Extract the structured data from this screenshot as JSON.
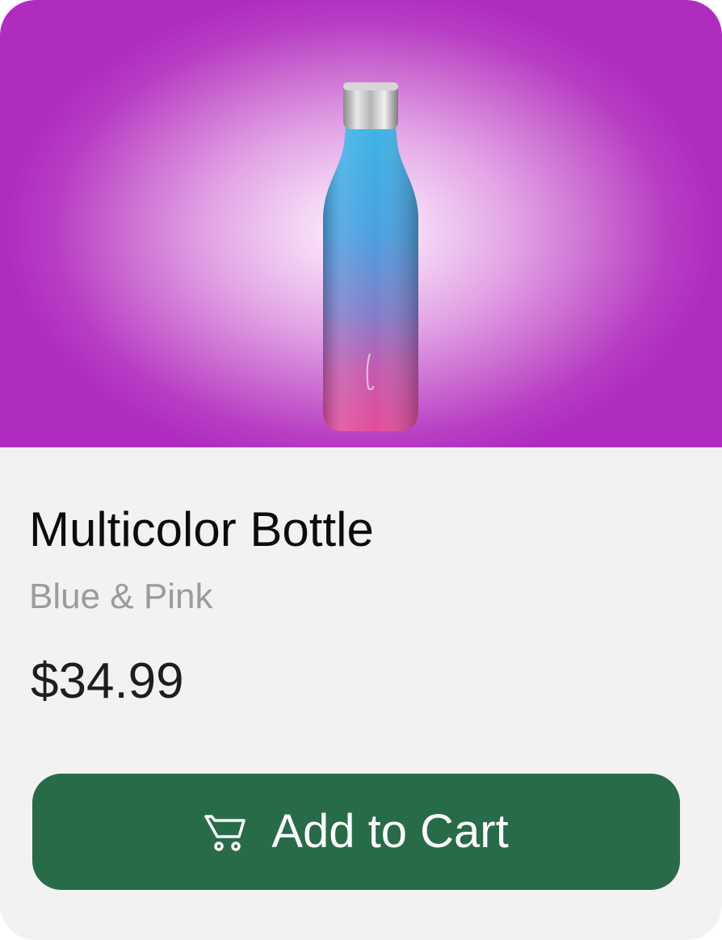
{
  "product": {
    "image_icon": "water-bottle-image",
    "name": "Multicolor Bottle",
    "variant": "Blue & Pink",
    "price": "$34.99"
  },
  "actions": {
    "add_to_cart_label": "Add to Cart",
    "cart_icon": "shopping-cart-icon"
  },
  "colors": {
    "hero_background": "#b02cc0",
    "button_background": "#276c47",
    "card_background": "#f2f2f2",
    "subtitle_text": "#9b9b9b"
  }
}
